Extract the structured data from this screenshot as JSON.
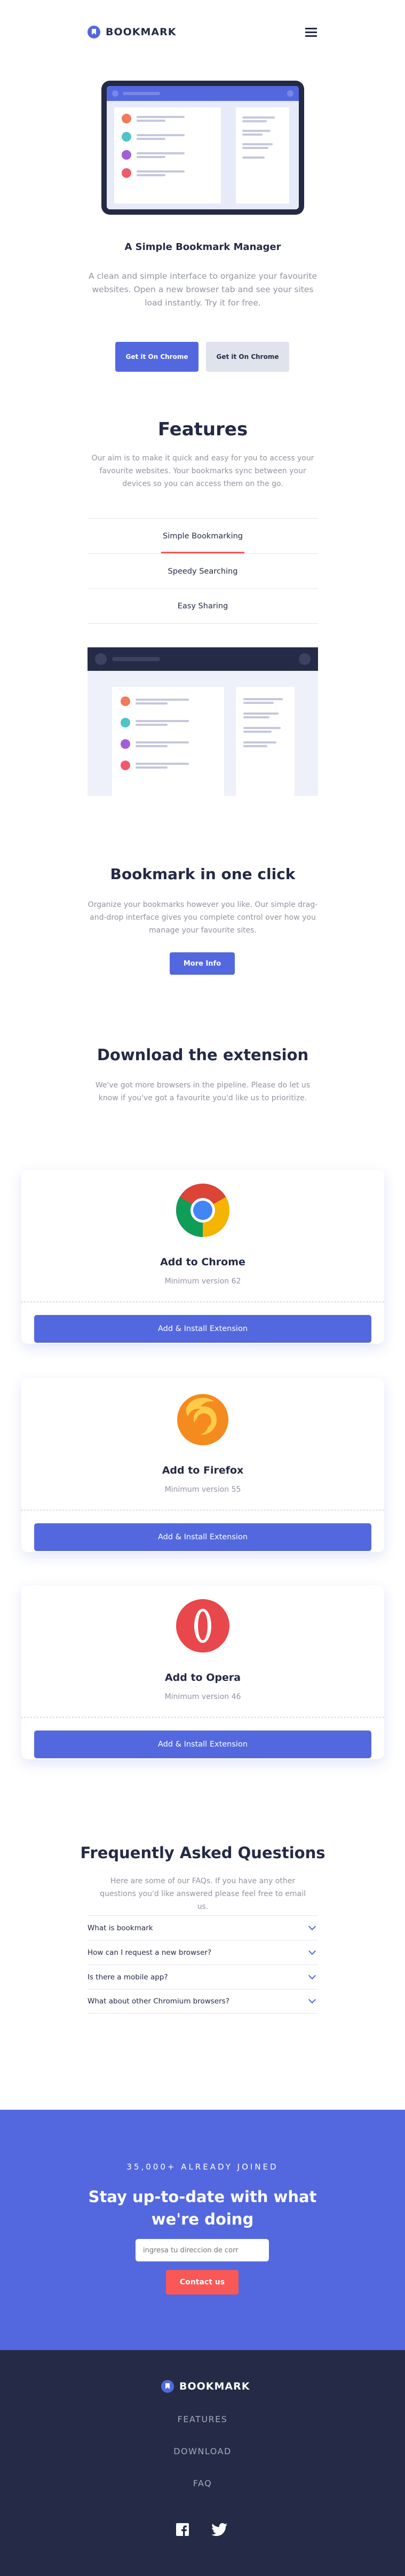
{
  "header": {
    "logo_text": "BOOKMARK",
    "logo_icon": "bookmark-icon",
    "menu_icon": "hamburger-icon"
  },
  "hero": {
    "title": "A Simple Bookmark Manager",
    "description": "A clean and simple interface to organize your favourite websites. Open a new browser tab and see your sites load instantly. Try it for free.",
    "chrome_button": "Get it On Chrome",
    "firefox_button": "Get it On Chrome"
  },
  "features": {
    "title": "Features",
    "description": "Our aim is to make it quick and easy for you to access your favourite websites. Your bookmarks sync between your devices so you can access them on the go.",
    "tabs": [
      {
        "label": "Simple Bookmarking",
        "active": true
      },
      {
        "label": "Speedy Searching",
        "active": false
      },
      {
        "label": "Easy Sharing",
        "active": false
      }
    ],
    "panel_title": "Bookmark in one click",
    "panel_description": "Organize your bookmarks however you like. Our simple drag-and-drop interface gives you complete control over how you manage your favourite sites.",
    "more_info": "More Info"
  },
  "download": {
    "title": "Download the extension",
    "description": "We've got more browsers in the pipeline. Please do let us know if you've got a favourite you'd like us to prioritize.",
    "cards": [
      {
        "name": "Add to Chrome",
        "version": "Minimum version 62",
        "button": "Add & Install Extension",
        "icon": "chrome-icon"
      },
      {
        "name": "Add to Firefox",
        "version": "Minimum version 55",
        "button": "Add & Install Extension",
        "icon": "firefox-icon"
      },
      {
        "name": "Add to Opera",
        "version": "Minimum version 46",
        "button": "Add & Install Extension",
        "icon": "opera-icon"
      }
    ]
  },
  "faq": {
    "title": "Frequently Asked Questions",
    "description": "Here are some of our FAQs. If you have any other questions you'd like answered please feel free to email us.",
    "items": [
      "What is bookmark",
      "How can I request a new browser?",
      "Is there a mobile app?",
      "What about other Chromium browsers?"
    ]
  },
  "newsletter": {
    "eyebrow": "35,000+ ALREADY JOINED",
    "title": "Stay up-to-date with what we're doing",
    "placeholder": "ingresa tu direccion de corr",
    "button": "Contact us"
  },
  "footer": {
    "logo_text": "BOOKMARK",
    "nav": [
      "FEATURES",
      "DOWNLOAD",
      "FAQ"
    ],
    "social": [
      "facebook-icon",
      "twitter-icon"
    ]
  },
  "colors": {
    "primary": "#5368df",
    "accent": "#fa5757",
    "dark": "#242a45",
    "grey_text": "#9194a1"
  }
}
